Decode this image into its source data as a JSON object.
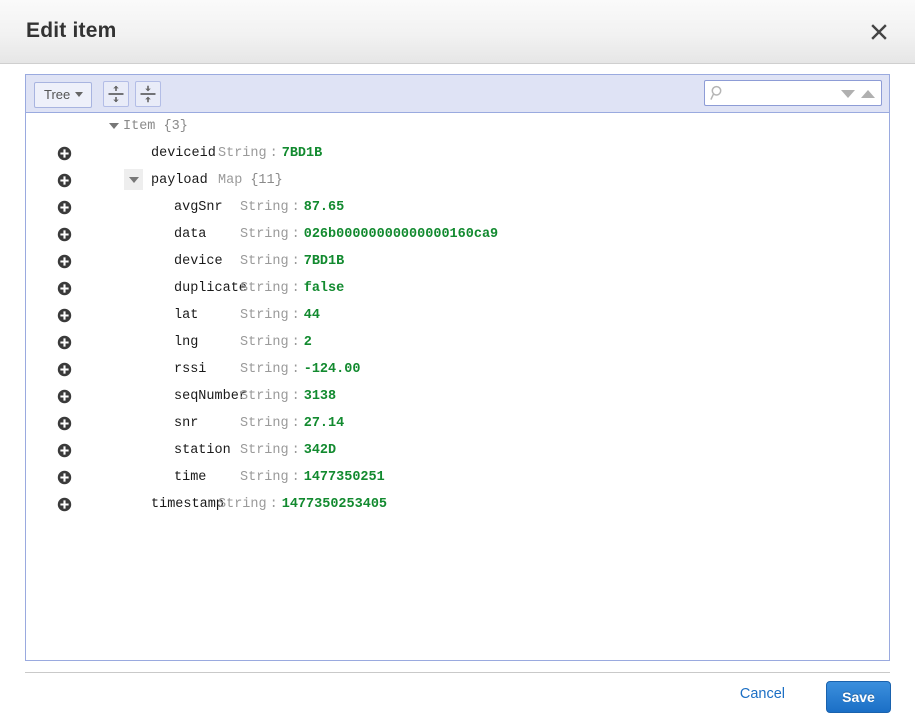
{
  "window": {
    "title": "Edit item",
    "close_icon": "close-icon"
  },
  "toolbar": {
    "mode_label": "Tree",
    "expand_all_icon": "expand-all-icon",
    "collapse_all_icon": "collapse-all-icon",
    "search": {
      "value": "",
      "placeholder": "",
      "icon": "search-icon",
      "next_icon": "search-next-icon",
      "previous_icon": "search-previous-icon"
    }
  },
  "tree": {
    "root": {
      "label": "Item",
      "count": "{3}",
      "expanded": true
    },
    "rows": [
      {
        "indent": 1,
        "name": "deviceid",
        "type": "String",
        "separator": ":",
        "value": "7BD1B",
        "has_plus": true,
        "has_triangle": false
      },
      {
        "indent": 1,
        "name": "payload",
        "type": "Map",
        "separator": "",
        "value": "{11}",
        "has_plus": true,
        "has_triangle": true
      },
      {
        "indent": 2,
        "name": "avgSnr",
        "type": "String",
        "separator": ":",
        "value": "87.65",
        "has_plus": true,
        "has_triangle": false
      },
      {
        "indent": 2,
        "name": "data",
        "type": "String",
        "separator": ":",
        "value": "026b00000000000000160ca9",
        "has_plus": true,
        "has_triangle": false
      },
      {
        "indent": 2,
        "name": "device",
        "type": "String",
        "separator": ":",
        "value": "7BD1B",
        "has_plus": true,
        "has_triangle": false
      },
      {
        "indent": 2,
        "name": "duplicate",
        "type": "String",
        "separator": ":",
        "value": "false",
        "has_plus": true,
        "has_triangle": false
      },
      {
        "indent": 2,
        "name": "lat",
        "type": "String",
        "separator": ":",
        "value": "44",
        "has_plus": true,
        "has_triangle": false
      },
      {
        "indent": 2,
        "name": "lng",
        "type": "String",
        "separator": ":",
        "value": "2",
        "has_plus": true,
        "has_triangle": false
      },
      {
        "indent": 2,
        "name": "rssi",
        "type": "String",
        "separator": ":",
        "value": "-124.00",
        "has_plus": true,
        "has_triangle": false
      },
      {
        "indent": 2,
        "name": "seqNumber",
        "type": "String",
        "separator": ":",
        "value": "3138",
        "has_plus": true,
        "has_triangle": false
      },
      {
        "indent": 2,
        "name": "snr",
        "type": "String",
        "separator": ":",
        "value": "27.14",
        "has_plus": true,
        "has_triangle": false
      },
      {
        "indent": 2,
        "name": "station",
        "type": "String",
        "separator": ":",
        "value": "342D",
        "has_plus": true,
        "has_triangle": false
      },
      {
        "indent": 2,
        "name": "time",
        "type": "String",
        "separator": ":",
        "value": "1477350251",
        "has_plus": true,
        "has_triangle": false
      },
      {
        "indent": 1,
        "name": "timestamp",
        "type": "String",
        "separator": ":",
        "value": "1477350253405",
        "has_plus": true,
        "has_triangle": false
      }
    ]
  },
  "footer": {
    "cancel_label": "Cancel",
    "save_label": "Save"
  },
  "colors": {
    "value_green": "#128a2f",
    "save_blue": "#1b6fc6",
    "link_blue": "#1c6fc4",
    "toolbar_lavender": "#dfe3f5",
    "panel_border": "#9aaadf"
  }
}
